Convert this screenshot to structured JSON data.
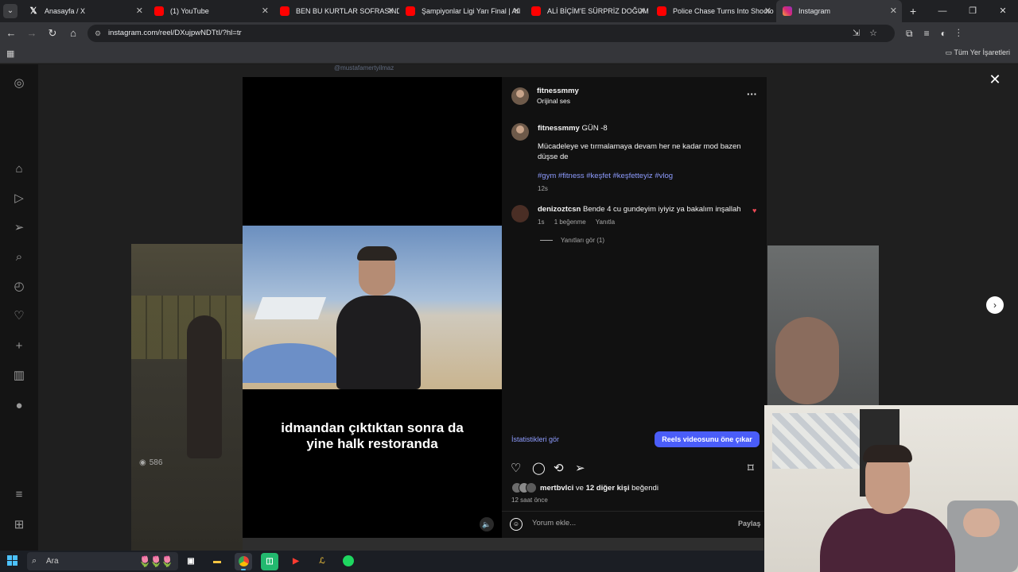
{
  "browser": {
    "tabs": [
      {
        "title": "Anasayfa / X",
        "icon": "x-icon"
      },
      {
        "title": "(1) YouTube",
        "icon": "youtube-icon"
      },
      {
        "title": "BEN BU KURTLAR SOFRASINDA",
        "icon": "youtube-icon"
      },
      {
        "title": "Şampiyonlar Ligi Yarı Final | Atl",
        "icon": "youtube-icon"
      },
      {
        "title": "ALİ BİÇİM'E SÜRPRİZ DOĞUM G",
        "icon": "youtube-icon"
      },
      {
        "title": "Police Chase Turns Into Shooto",
        "icon": "youtube-icon"
      },
      {
        "title": "Instagram",
        "icon": "instagram-icon"
      }
    ],
    "url": "instagram.com/reel/DXujpwNDTtI/?hl=tr",
    "all_bookmarks": "Tüm Yer İşaretleri"
  },
  "reel": {
    "caption_line1": "idmandan çıktıktan sonra da",
    "caption_line2": "yine halk restoranda"
  },
  "background": {
    "left_views": "586",
    "top_handle": "@mustafamertyilmaz"
  },
  "post": {
    "username": "fitnessmmy",
    "audio": "Orijinal ses",
    "caption_user": "fitnessmmy",
    "caption_title": "GÜN -8",
    "caption_text": "Mücadeleye ve tırmalamaya devam her ne kadar mod bazen düşse de",
    "hashtags": "#gym #fitness #keşfet #keşfetteyiz #vlog",
    "caption_time": "12s",
    "comment": {
      "user": "denizoztcsn",
      "text": "Bende 4 cu gundeyim iyiyiz ya bakalım inşallah",
      "time": "1s",
      "likes": "1 beğenme",
      "reply": "Yanıtla",
      "view_replies": "Yanıtları gör (1)"
    },
    "stats_link": "İstatistikleri gör",
    "boost_button": "Reels videosunu öne çıkar",
    "liked_by_user": "mertbvlci",
    "liked_by_rest": "ve",
    "liked_by_others": "12 diğer kişi",
    "liked_by_suffix": "beğendi",
    "post_time": "12 saat önce",
    "comment_placeholder": "Yorum ekle...",
    "share_label": "Paylaş"
  },
  "taskbar": {
    "search_label": "Ara"
  },
  "colors": {
    "link_blue": "#8e9cff",
    "boost_blue": "#4a5df9",
    "heart_red": "#ed4956",
    "accent_blue": "#4cc2ff"
  }
}
